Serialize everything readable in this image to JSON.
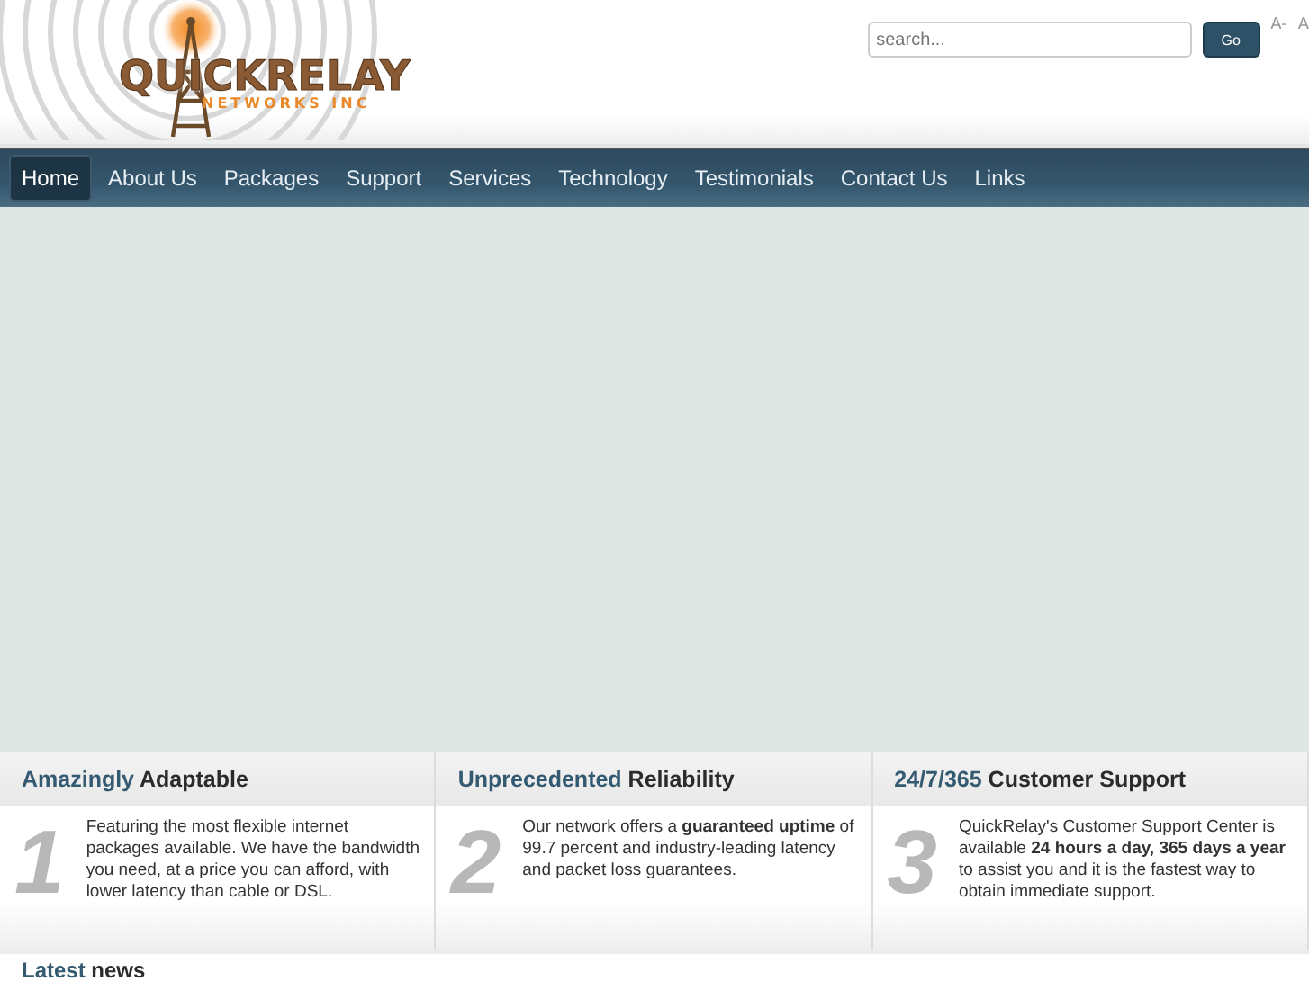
{
  "logo": {
    "name": "QUICKRELAY",
    "tagline": "NETWORKS INC"
  },
  "search": {
    "placeholder": "search...",
    "button": "Go"
  },
  "font_size_controls": [
    "A-",
    "A"
  ],
  "nav": [
    {
      "label": "Home",
      "selected": true
    },
    {
      "label": "About Us",
      "selected": false
    },
    {
      "label": "Packages",
      "selected": false
    },
    {
      "label": "Support",
      "selected": false
    },
    {
      "label": "Services",
      "selected": false
    },
    {
      "label": "Technology",
      "selected": false
    },
    {
      "label": "Testimonials",
      "selected": false
    },
    {
      "label": "Contact Us",
      "selected": false
    },
    {
      "label": "Links",
      "selected": false
    }
  ],
  "features": [
    {
      "accent": "Amazingly",
      "title": "Adaptable",
      "number": "1",
      "text": "Featuring the most flexible internet packages available. We have the bandwidth you need, at a price you can afford, with lower latency than cable or DSL."
    },
    {
      "accent": "Unprecedented",
      "title": "Reliability",
      "number": "2",
      "text": "Our network offers a **guaranteed uptime** of 99.7 percent and industry-leading latency and packet loss guarantees."
    },
    {
      "accent": "24/7/365",
      "title": "Customer Support",
      "number": "3",
      "text": "QuickRelay's Customer Support Center is available **24 hours a day, 365 days a year** to assist you and it is the fastest way to obtain immediate support."
    }
  ],
  "news": {
    "accent": "Latest",
    "title": "news"
  }
}
